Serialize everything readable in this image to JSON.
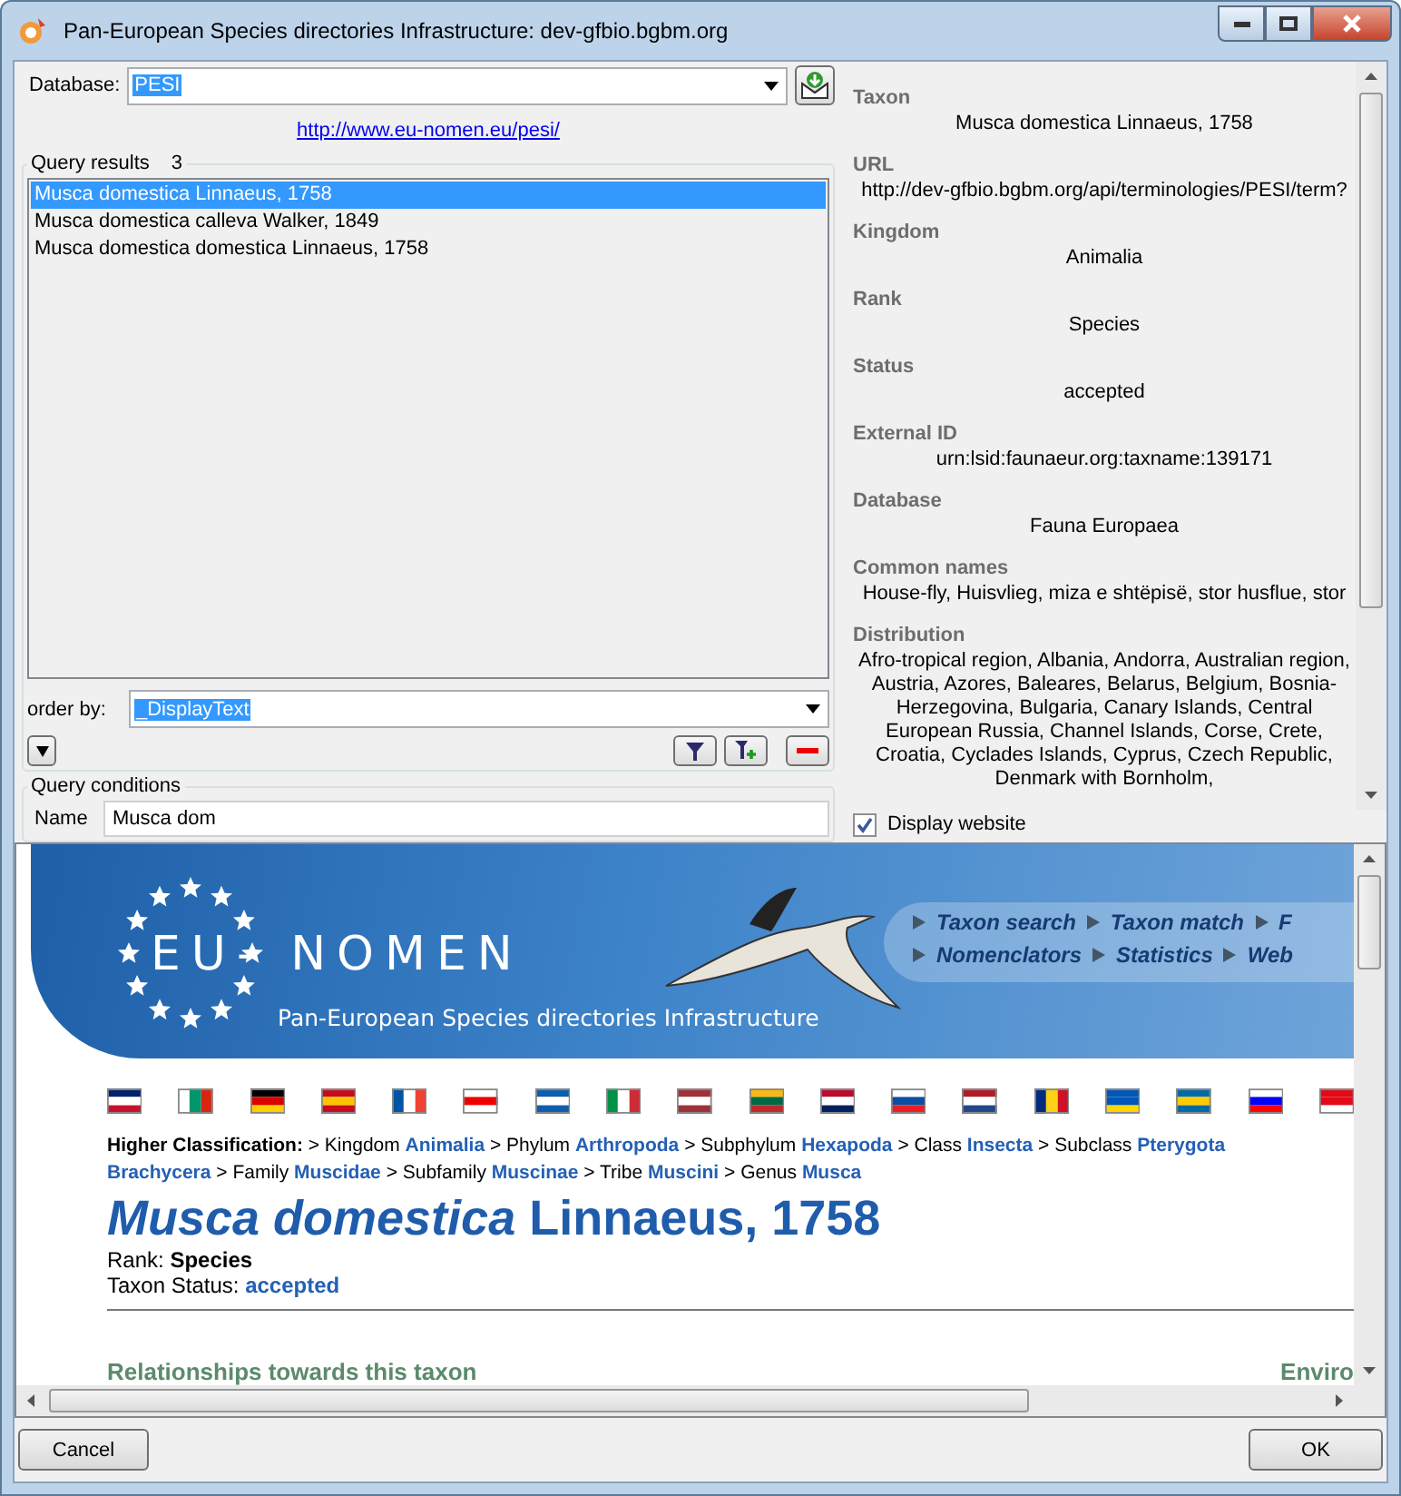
{
  "window": {
    "title": "Pan-European Species directories Infrastructure: dev-gfbio.bgbm.org"
  },
  "database": {
    "label": "Database:",
    "value": "PESI"
  },
  "link": "http://www.eu-nomen.eu/pesi/",
  "query_results": {
    "label": "Query results",
    "count": "3",
    "items": [
      {
        "text": "Musca domestica Linnaeus, 1758",
        "selected": true
      },
      {
        "text": "Musca domestica calleva Walker, 1849",
        "selected": false
      },
      {
        "text": "Musca domestica domestica Linnaeus, 1758",
        "selected": false
      }
    ]
  },
  "order_by": {
    "label": "order by:",
    "value": "_DisplayText"
  },
  "query_conditions": {
    "label": "Query conditions",
    "fields": [
      {
        "label": "Name",
        "value": "Musca dom"
      }
    ]
  },
  "details": [
    {
      "label": "Taxon",
      "value": "Musca domestica Linnaeus, 1758"
    },
    {
      "label": "URL",
      "value": "http://dev-gfbio.bgbm.org/api/terminologies/PESI/term?"
    },
    {
      "label": "Kingdom",
      "value": "Animalia"
    },
    {
      "label": "Rank",
      "value": "Species"
    },
    {
      "label": "Status",
      "value": "accepted"
    },
    {
      "label": "External ID",
      "value": "urn:lsid:faunaeur.org:taxname:139171"
    },
    {
      "label": "Database",
      "value": "Fauna Europaea"
    },
    {
      "label": "Common names",
      "value": "House-fly, Huisvlieg, miza e shtëpisë, stor husflue, stor"
    },
    {
      "label": "Distribution",
      "value": "Afro-tropical region, Albania, Andorra, Australian region, Austria, Azores, Baleares, Belarus, Belgium, Bosnia-Herzegovina, Bulgaria, Canary Islands, Central European Russia, Channel Islands, Corse, Crete, Croatia, Cyclades Islands, Cyprus, Czech Republic, Denmark with Bornholm,"
    }
  ],
  "display_website": {
    "label": "Display website",
    "checked": true
  },
  "website": {
    "logo": "EU- NOMEN",
    "subtitle": "Pan-European Species directories Infrastructure",
    "nav": [
      [
        "Taxon search",
        "Taxon match",
        "F"
      ],
      [
        "Nomenclators",
        "Statistics",
        "Web"
      ]
    ],
    "classification_label": "Higher Classification:",
    "classification_lines": [
      [
        {
          "rank": "> Kingdom",
          "name": "Animalia"
        },
        {
          "rank": "> Phylum",
          "name": "Arthropoda"
        },
        {
          "rank": "> Subphylum",
          "name": "Hexapoda"
        },
        {
          "rank": "> Class",
          "name": "Insecta"
        },
        {
          "rank": "> Subclass",
          "name": "Pterygota"
        }
      ],
      [
        {
          "name": "Brachycera"
        },
        {
          "rank": "> Family",
          "name": "Muscidae"
        },
        {
          "rank": "> Subfamily",
          "name": "Muscinae"
        },
        {
          "rank": "> Tribe",
          "name": "Muscini"
        },
        {
          "rank": "> Genus",
          "name": "Musca"
        }
      ]
    ],
    "heading": "*Musca domestica* Linnaeus, 1758",
    "rank_label": "Rank:",
    "rank": "Species",
    "status_label": "Taxon Status:",
    "status": "accepted",
    "section": "Relationships towards this taxon",
    "section_right": "Enviro"
  },
  "buttons": [
    {
      "label": "Cancel",
      "kind": "cancel"
    },
    {
      "label": "OK",
      "kind": "ok"
    }
  ]
}
